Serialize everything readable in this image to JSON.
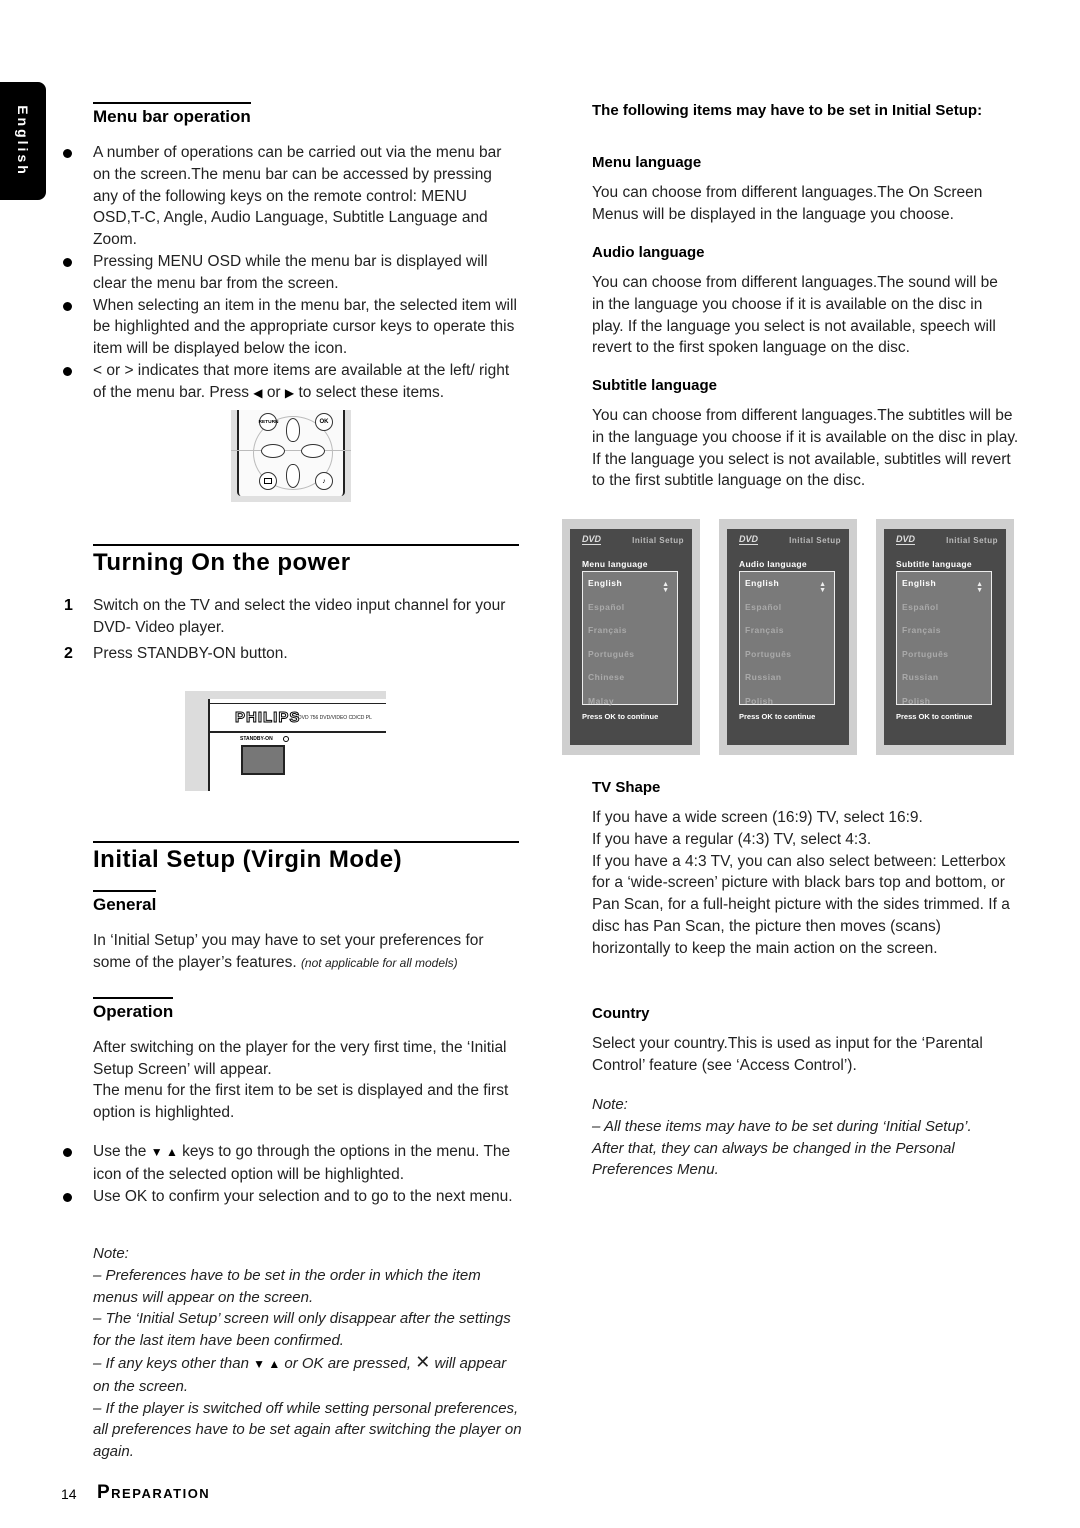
{
  "language_tab": "English",
  "menu_bar": {
    "heading": "Menu bar operation",
    "bullets": [
      "A number of operations can be carried out via the menu bar on the screen.The menu bar can be accessed by pressing any of the following keys on the remote control: MENU OSD,T-C, Angle, Audio Language, Subtitle Language and Zoom.",
      "Pressing MENU OSD while the menu bar is displayed will clear the menu bar from the screen.",
      "When selecting an item in the menu bar, the selected item will be highlighted and the appropriate cursor keys to operate this item will be displayed below the icon."
    ],
    "bullet4_pre": "< or > indicates that more items are available at the left/ right of the menu bar. Press",
    "bullet4_left": "◀",
    "bullet4_mid": "or",
    "bullet4_right": "▶",
    "bullet4_post": "to select these items.",
    "remote": {
      "return_label": "RETURN",
      "ok_label": "OK"
    }
  },
  "turning_on": {
    "heading": "Turning On the power",
    "steps": [
      {
        "num": "1",
        "text": "Switch on the TV and select the video input channel for your DVD- Video player."
      },
      {
        "num": "2",
        "text": "Press STANDBY-ON button."
      }
    ],
    "player": {
      "brand": "PHILIPS",
      "model": "DVD 756  DVD/VIDEO CD/CD PL",
      "standby_label": "STANDBY-ON"
    }
  },
  "initial_setup": {
    "heading": "Initial Setup (Virgin Mode)",
    "general": {
      "heading": "General",
      "text": "In ‘Initial Setup’ you may have to set your preferences for some of the player’s features.",
      "text_note": "(not applicable for all models)"
    },
    "operation": {
      "heading": "Operation",
      "para1": "After switching on the player for the very first time, the ‘Initial Setup Screen’ will appear.",
      "para2": "The menu for the first item to be set is displayed and the first option is highlighted.",
      "bullet1_pre": "Use the",
      "bullet1_keys": "▼ ▲",
      "bullet1_post": "keys to go through the options in the menu. The icon of the selected option will be highlighted.",
      "bullet2": "Use OK to confirm your selection and to go to the next menu."
    },
    "note": {
      "label": "Note:",
      "items": [
        "–  Preferences have to be set in the order in which the item menus will appear on the screen.",
        "–  The ‘Initial Setup’ screen will only disappear after the settings for the last item have been confirmed."
      ],
      "item3_pre": "–  If any keys other than",
      "item3_keys": "▼ ▲",
      "item3_mid": "or OK are pressed,",
      "item3_icon": "✕",
      "item3_post": "will appear on the screen.",
      "item4": "–  If the player is switched off while setting personal preferences, all preferences have to be set again after switching the player on again."
    }
  },
  "right": {
    "intro": "The following items may have to be set in Initial Setup:",
    "sections": [
      {
        "heading": "Menu language",
        "text": "You can choose from different languages.The On Screen Menus will be displayed in the language you choose."
      },
      {
        "heading": "Audio language",
        "text": "You can choose from different languages.The sound will be in the language you choose if it is available on the disc in play. If the language you select is not available, speech will revert to the first spoken language on the disc."
      },
      {
        "heading": "Subtitle language",
        "text": "You can choose from different languages.The subtitles will be in the language you choose if it is available on the disc in play. If the language you select is not available, subtitles will revert to the first subtitle language on the disc."
      }
    ],
    "screens": [
      {
        "logo": "DVD",
        "title": "Initial Setup",
        "label": "Menu language",
        "options": [
          "English",
          "Español",
          "Français",
          "Português",
          "Chinese",
          "Malay"
        ],
        "selected": "English",
        "footer": "Press OK to continue"
      },
      {
        "logo": "DVD",
        "title": "Initial Setup",
        "label": "Audio language",
        "options": [
          "English",
          "Español",
          "Français",
          "Português",
          "Russian",
          "Polish"
        ],
        "selected": "English",
        "footer": "Press OK to continue"
      },
      {
        "logo": "DVD",
        "title": "Initial Setup",
        "label": "Subtitle language",
        "options": [
          "English",
          "Español",
          "Français",
          "Português",
          "Russian",
          "Polish"
        ],
        "selected": "English",
        "footer": "Press OK to continue"
      }
    ],
    "tv_shape": {
      "heading": "TV Shape",
      "lines": [
        "If you have a wide screen (16:9) TV, select 16:9.",
        "If you have a regular (4:3) TV, select 4:3.",
        "If you have a 4:3 TV, you can also select between: Letterbox for a ‘wide-screen’ picture with black bars top and bottom, or Pan Scan, for a full-height picture with the sides trimmed. If a disc has Pan Scan, the picture then moves (scans) horizontally to keep the main action on the screen."
      ]
    },
    "country": {
      "heading": "Country",
      "text": "Select your country.This is used as input for the ‘Parental Control’ feature (see ‘Access Control’)."
    },
    "note": {
      "label": "Note:",
      "text": "–  All these items may have to be set during ‘Initial Setup’. After that, they can always be changed in the Personal Preferences Menu."
    }
  },
  "footer": {
    "page_number": "14",
    "section": "Preparation"
  }
}
